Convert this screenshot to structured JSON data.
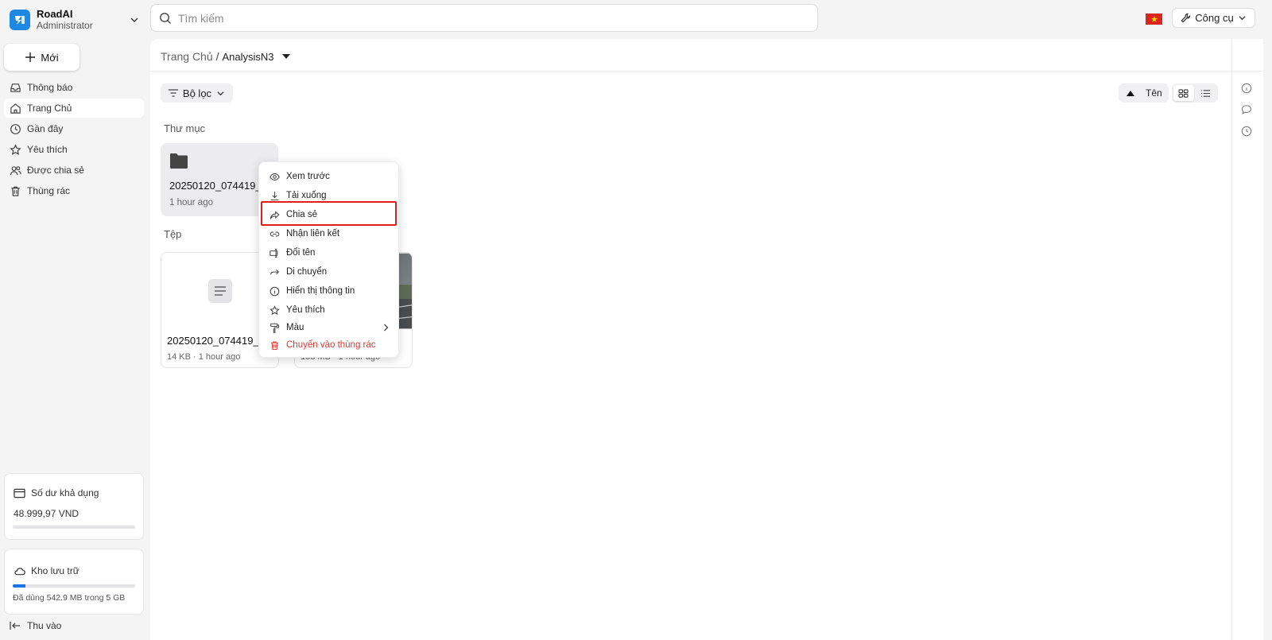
{
  "brand": {
    "name": "RoadAI",
    "role": "Administrator"
  },
  "sidebar": {
    "new_label": "Mới",
    "items": [
      {
        "label": "Thông báo",
        "icon": "inbox-icon"
      },
      {
        "label": "Trang Chủ",
        "icon": "home-icon",
        "active": true
      },
      {
        "label": "Gần đây",
        "icon": "clock-icon"
      },
      {
        "label": "Yêu thích",
        "icon": "star-icon"
      },
      {
        "label": "Được chia sẻ",
        "icon": "users-icon"
      },
      {
        "label": "Thùng rác",
        "icon": "trash-icon"
      }
    ],
    "balance": {
      "label": "Số dư khả dụng",
      "value": "48.999,97 VND"
    },
    "storage": {
      "label": "Kho lưu trữ",
      "usage_text": "Đã dùng 542.9 MB trong 5 GB",
      "used_fraction": 0.106
    },
    "collapse_label": "Thu vào"
  },
  "header": {
    "search_placeholder": "Tìm kiếm",
    "tools_label": "Công cụ"
  },
  "breadcrumb": {
    "root": "Trang Chủ",
    "separator": "/",
    "current": "AnalysisN3"
  },
  "toolbar": {
    "filter_label": "Bộ lọc",
    "sort_label": "Tên",
    "sort_direction": "ascending",
    "view": "grid"
  },
  "sections": {
    "folders_title": "Thư mục",
    "files_title": "Tệp"
  },
  "folders": [
    {
      "name": "20250120_074419_",
      "time": "1 hour ago"
    }
  ],
  "files": [
    {
      "name": "20250120_074419_E",
      "meta": "14 KB · 1 hour ago",
      "kind": "document"
    },
    {
      "name": "...",
      "meta": "183 MB · 1 hour ago",
      "kind": "video"
    }
  ],
  "context_menu": {
    "items": [
      {
        "label": "Xem trước",
        "icon": "eye-icon"
      },
      {
        "label": "Tải xuống",
        "icon": "download-icon"
      },
      {
        "label": "Chia sẻ",
        "icon": "share-icon",
        "highlighted": true
      },
      {
        "label": "Nhận liên kết",
        "icon": "link-icon"
      },
      {
        "label": "Đổi tên",
        "icon": "rename-icon"
      },
      {
        "label": "Di chuyển",
        "icon": "move-icon"
      },
      {
        "label": "Hiển thị thông tin",
        "icon": "info-icon"
      },
      {
        "label": "Yêu thích",
        "icon": "star-icon"
      },
      {
        "label": "Màu",
        "icon": "paint-roller-icon",
        "submenu": true
      },
      {
        "label": "Chuyển vào thùng rác",
        "icon": "trash-icon",
        "danger": true
      }
    ]
  },
  "colors": {
    "accent": "#1a73e8",
    "danger": "#e5342f",
    "highlight_border": "#e31c1c",
    "logo": "#1e88e5"
  }
}
